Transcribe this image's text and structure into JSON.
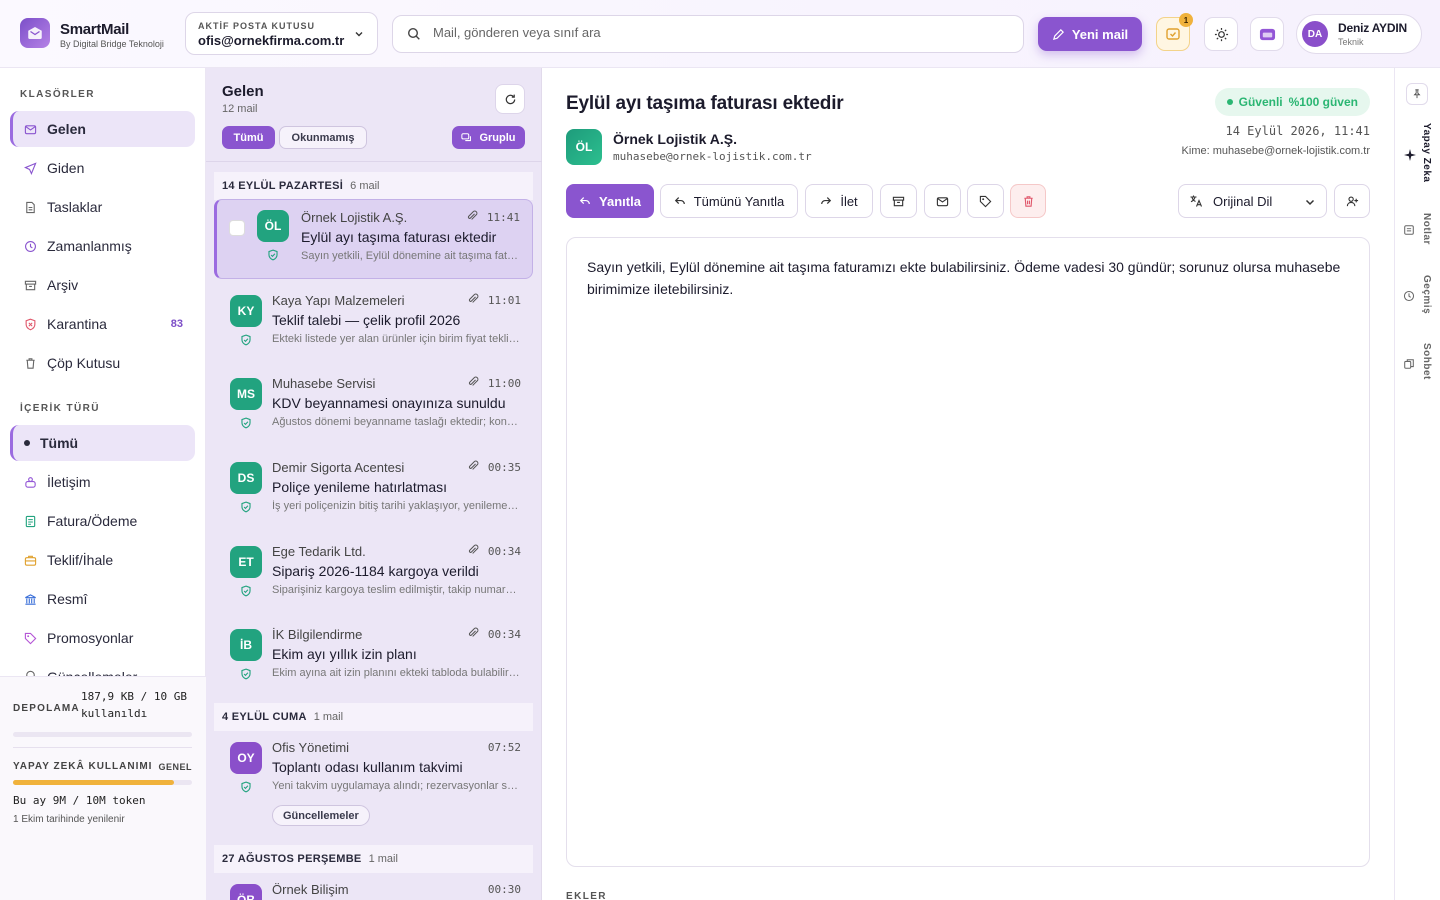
{
  "header": {
    "brand_name": "SmartMail",
    "brand_sub": "By Digital Bridge Teknoloji",
    "account_label": "AKTİF POSTA KUTUSU",
    "account_value": "ofis@ornekfirma.com.tr",
    "search_placeholder": "Mail, gönderen veya sınıf ara",
    "new_mail": "Yeni mail",
    "task_badge": "1",
    "user_initials": "DA",
    "user_name": "Deniz AYDIN",
    "user_role": "Teknik"
  },
  "sidebar": {
    "folders_title": "KLASÖRLER",
    "folders": [
      {
        "label": "Gelen",
        "icon": "inbox-icon",
        "active": true
      },
      {
        "label": "Giden",
        "icon": "send-icon"
      },
      {
        "label": "Taslaklar",
        "icon": "draft-icon"
      },
      {
        "label": "Zamanlanmış",
        "icon": "clock-icon"
      },
      {
        "label": "Arşiv",
        "icon": "archive-icon"
      },
      {
        "label": "Karantina",
        "icon": "shield-icon",
        "count": "83"
      },
      {
        "label": "Çöp Kutusu",
        "icon": "trash-icon"
      }
    ],
    "content_title": "İÇERİK TÜRÜ",
    "content_types": [
      {
        "label": "Tümü",
        "active": true
      },
      {
        "label": "İletişim",
        "icon": "people-icon"
      },
      {
        "label": "Fatura/Ödeme",
        "icon": "invoice-icon"
      },
      {
        "label": "Teklif/İhale",
        "icon": "briefcase-icon"
      },
      {
        "label": "Resmî",
        "icon": "bank-icon"
      },
      {
        "label": "Promosyonlar",
        "icon": "tag-icon"
      },
      {
        "label": "Güncellemeler",
        "icon": "bell-icon"
      }
    ],
    "storage_label": "DEPOLAMA",
    "storage_value_1": "187,9 KB / 10 GB",
    "storage_value_2": "kullanıldı",
    "storage_fraction": 0.0,
    "ai_label": "YAPAY ZEKÂ KULLANIMI",
    "ai_scope": "GENEL",
    "ai_value": "Bu ay 9M / 10M token",
    "ai_fraction": 0.9,
    "ai_renew": "1 Ekim tarihinde yenilenir"
  },
  "list": {
    "title": "Gelen",
    "count": "12 mail",
    "filter_all": "Tümü",
    "filter_unread": "Okunmamış",
    "group_toggle": "Gruplu",
    "groups": [
      {
        "label": "14 EYLÜL PAZARTESİ",
        "count": "6 mail"
      },
      {
        "label": "4 EYLÜL CUMA",
        "count": "1 mail"
      },
      {
        "label": "27 AĞUSTOS PERŞEMBE",
        "count": "1 mail"
      }
    ],
    "items": [
      {
        "initials": "ÖL",
        "sender": "Örnek Lojistik A.Ş.",
        "time": "11:41",
        "subject": "Eylül ayı taşıma faturası ektedir",
        "preview": "Sayın yetkili, Eylül dönemine ait taşıma faturamızı ekte bulabilirsiniz.",
        "color": "#22a37f"
      },
      {
        "initials": "KY",
        "sender": "Kaya Yapı Malzemeleri",
        "time": "11:01",
        "subject": "Teklif talebi — çelik profil 2026",
        "preview": "Ekteki listede yer alan ürünler için birim fiyat teklifinizi rica ederiz.",
        "color": "#22a37f"
      },
      {
        "initials": "MS",
        "sender": "Muhasebe Servisi",
        "time": "11:00",
        "subject": "KDV beyannamesi onayınıza sunuldu",
        "preview": "Ağustos dönemi beyanname taslağı ektedir; kontrol edip onaylayınız.",
        "color": "#22a37f"
      },
      {
        "initials": "DS",
        "sender": "Demir Sigorta Acentesi",
        "time": "00:35",
        "subject": "Poliçe yenileme hatırlatması",
        "preview": "İş yeri poliçenizin bitiş tarihi yaklaşıyor, yenileme için bize ulaşın.",
        "color": "#22a37f"
      },
      {
        "initials": "ET",
        "sender": "Ege Tedarik Ltd.",
        "time": "00:34",
        "subject": "Sipariş 2026-1184 kargoya verildi",
        "preview": "Siparişiniz kargoya teslim edilmiştir, takip numarası ektedir.",
        "color": "#22a37f"
      },
      {
        "initials": "İB",
        "sender": "İK Bilgilendirme",
        "time": "00:34",
        "subject": "Ekim ayı yıllık izin planı",
        "preview": "Ekim ayına ait izin planını ekteki tabloda bulabilirsiniz.",
        "color": "#22a37f"
      },
      {
        "initials": "OY",
        "sender": "Ofis Yönetimi",
        "time": "07:52",
        "subject": "Toplantı odası kullanım takvimi",
        "preview": "Yeni takvim uygulamaya alındı; rezervasyonlar sistem üzerinden yapılır.",
        "color": "#8a4fca",
        "tag": "Güncellemeler"
      },
      {
        "initials": "ÖB",
        "sender": "Örnek Bilişim",
        "time": "00:30",
        "color": "#8a4fca"
      }
    ]
  },
  "reader": {
    "subject": "Eylül ayı taşıma faturası ektedir",
    "trust_label": "Güvenli",
    "trust_value": "%100 güven",
    "sender_initials": "ÖL",
    "sender_name": "Örnek Lojistik A.Ş.",
    "sender_email": "muhasebe@ornek-lojistik.com.tr",
    "date": "14 Eylül 2026, 11:41",
    "to": "Kime: muhasebe@ornek-lojistik.com.tr",
    "reply": "Yanıtla",
    "reply_all": "Tümünü Yanıtla",
    "forward": "İlet",
    "language": "Orijinal Dil",
    "body": "Sayın yetkili, Eylül dönemine ait taşıma faturamızı ekte bulabilirsiniz. Ödeme vadesi 30 gündür; sorunuz olursa muhasebe birimimize iletebilirsiniz.",
    "attachments_title": "EKLER"
  },
  "rail": {
    "ai": "Yapay Zeka",
    "notes": "Notlar",
    "history": "Geçmiş",
    "chat": "Sohbet"
  }
}
